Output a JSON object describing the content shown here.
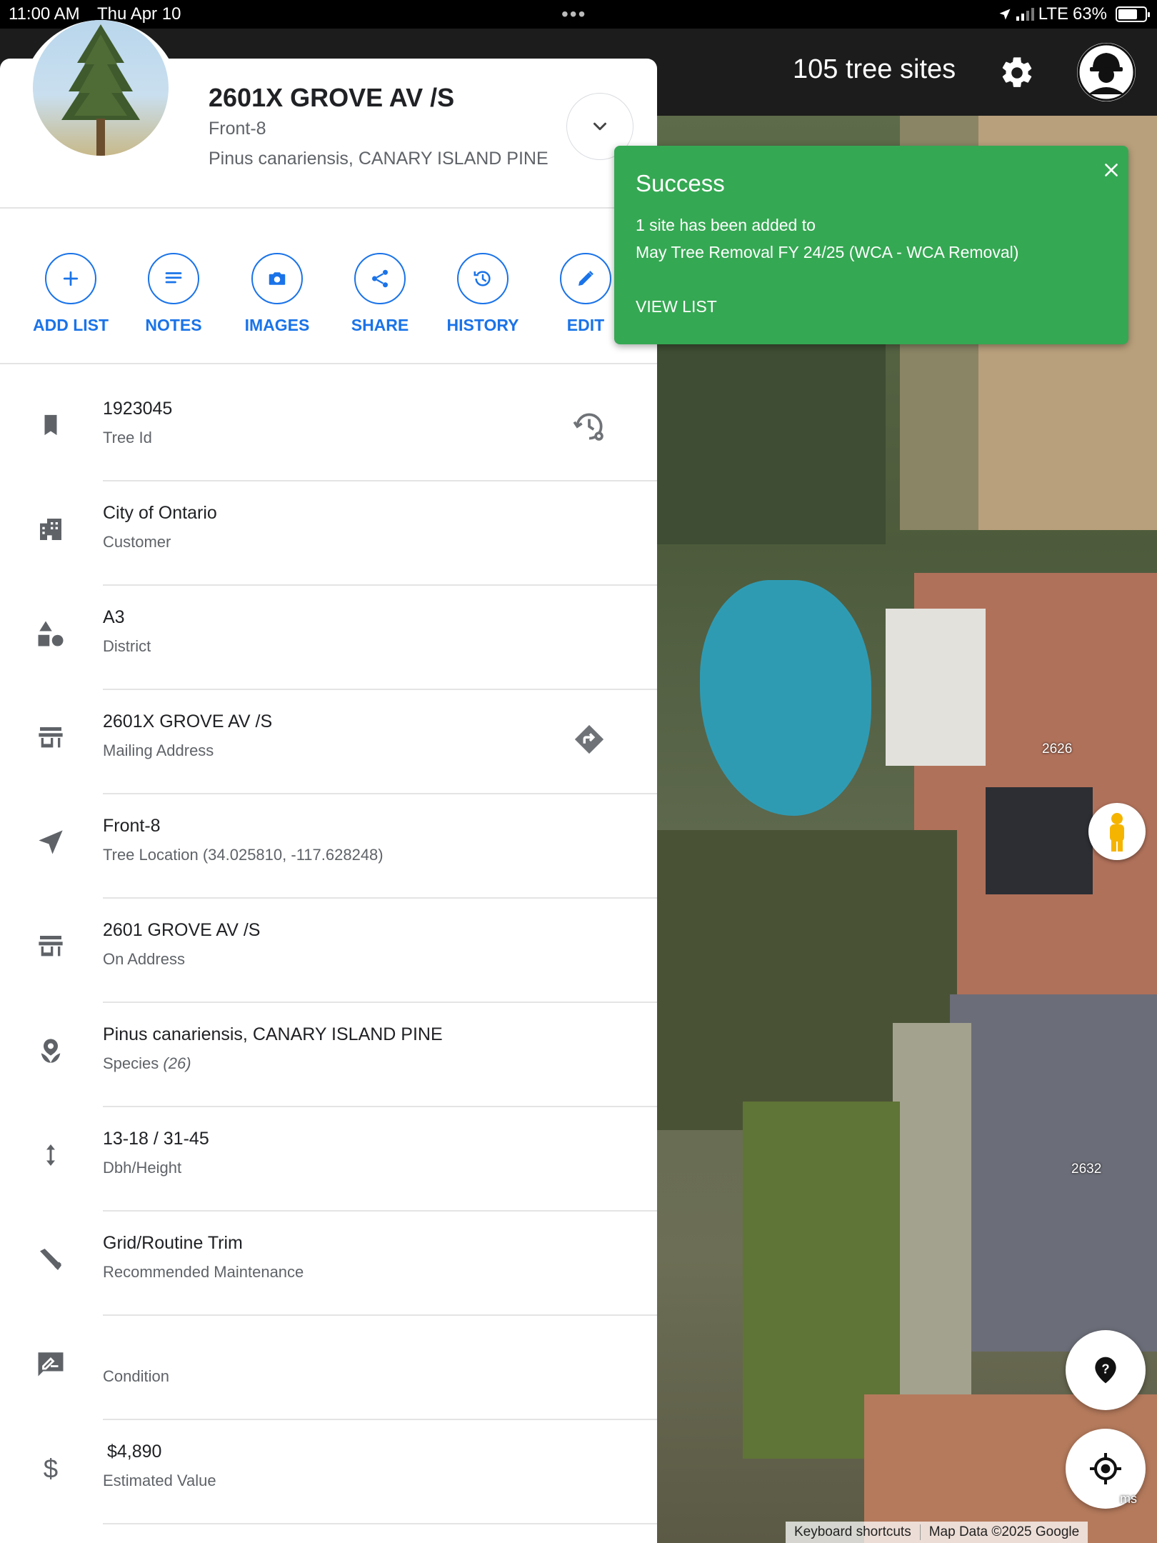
{
  "status_bar": {
    "time": "11:00 AM",
    "date": "Thu Apr 10",
    "network": "LTE",
    "battery": "63%"
  },
  "app_bar": {
    "site_count": "105 tree sites",
    "settings_icon": "gear-icon",
    "profile_icon": "worker-avatar-icon"
  },
  "site": {
    "title": "2601X GROVE AV /S",
    "location": "Front-8",
    "species": "Pinus canariensis, CANARY ISLAND PINE"
  },
  "actions": [
    {
      "label": "ADD LIST",
      "icon": "add-icon"
    },
    {
      "label": "NOTES",
      "icon": "notes-icon"
    },
    {
      "label": "IMAGES",
      "icon": "camera-icon"
    },
    {
      "label": "SHARE",
      "icon": "share-icon"
    },
    {
      "label": "HISTORY",
      "icon": "history-icon"
    },
    {
      "label": "EDIT",
      "icon": "edit-icon"
    }
  ],
  "details": [
    {
      "value": "1923045",
      "label": "Tree Id",
      "icon": "bookmark-icon"
    },
    {
      "value": "City of Ontario",
      "label": "Customer",
      "icon": "building-icon"
    },
    {
      "value": "A3",
      "label": "District",
      "icon": "shapes-icon"
    },
    {
      "value": "2601X GROVE AV /S",
      "label": "Mailing Address",
      "icon": "store-icon"
    },
    {
      "value": "Front-8",
      "label": "Tree Location (34.025810, -117.628248)",
      "icon": "navigation-icon"
    },
    {
      "value": "2601 GROVE AV /S",
      "label": "On Address",
      "icon": "store-icon"
    },
    {
      "value": "Pinus canariensis, CANARY ISLAND PINE",
      "label": "Species",
      "label_extra": "(26)",
      "icon": "tree-species-icon"
    },
    {
      "value": "13-18 / 31-45",
      "label": "Dbh/Height",
      "icon": "height-icon"
    },
    {
      "value": "Grid/Routine Trim",
      "label": "Recommended Maintenance",
      "icon": "saw-icon"
    },
    {
      "value": "",
      "label": "Condition",
      "icon": "rate-review-icon"
    },
    {
      "value": "$4,890",
      "label": "Estimated Value",
      "icon": "dollar-icon"
    }
  ],
  "toast": {
    "title": "Success",
    "message_line1": "1 site has been added to",
    "message_line2": "May Tree Removal FY 24/25 (WCA - WCA Removal)",
    "link": "VIEW LIST",
    "color": "#35a853"
  },
  "map": {
    "labels": [
      "2626",
      "2632"
    ],
    "attribution": [
      "Keyboard shortcuts",
      "Map Data ©2025 Google"
    ],
    "corner_text": "ms"
  },
  "colors": {
    "accent": "#1a73e8",
    "success": "#35a853",
    "appbar": "#1c1c1c"
  }
}
